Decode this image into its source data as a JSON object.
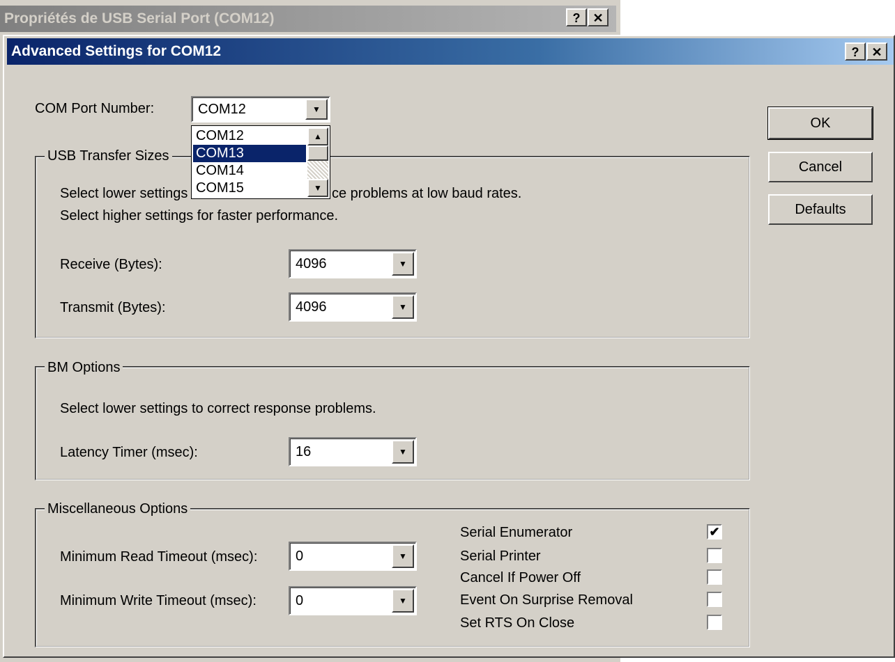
{
  "bg_window": {
    "title": "Propriétés de USB Serial Port (COM12)",
    "help_label": "?",
    "close_label": "✕"
  },
  "dialog": {
    "title": "Advanced Settings for COM12",
    "help_label": "?",
    "close_label": "✕",
    "com_port": {
      "label": "COM Port Number:",
      "value": "COM12",
      "options": [
        "COM12",
        "COM13",
        "COM14",
        "COM15"
      ],
      "highlighted": "COM13"
    },
    "usb_transfer": {
      "title": "USB Transfer Sizes",
      "line1": "Select lower settings to correct performance problems at low baud rates.",
      "line1_visible_end": "ce problems at low baud rates.",
      "line1_visible_start": "Select lower settings",
      "line2": "Select higher settings for faster performance.",
      "receive_label": "Receive (Bytes):",
      "receive_value": "4096",
      "transmit_label": "Transmit (Bytes):",
      "transmit_value": "4096"
    },
    "bm_options": {
      "title": "BM Options",
      "note": "Select lower settings to correct response problems.",
      "latency_label": "Latency Timer (msec):",
      "latency_value": "16"
    },
    "misc": {
      "title": "Miscellaneous Options",
      "read_label": "Minimum Read Timeout (msec):",
      "read_value": "0",
      "write_label": "Minimum Write Timeout (msec):",
      "write_value": "0",
      "checks": [
        {
          "label": "Serial Enumerator",
          "checked": true
        },
        {
          "label": "Serial Printer",
          "checked": false
        },
        {
          "label": "Cancel If Power Off",
          "checked": false
        },
        {
          "label": "Event On Surprise Removal",
          "checked": false
        },
        {
          "label": "Set RTS On Close",
          "checked": false
        }
      ]
    },
    "buttons": {
      "ok": "OK",
      "cancel": "Cancel",
      "defaults": "Defaults"
    }
  }
}
